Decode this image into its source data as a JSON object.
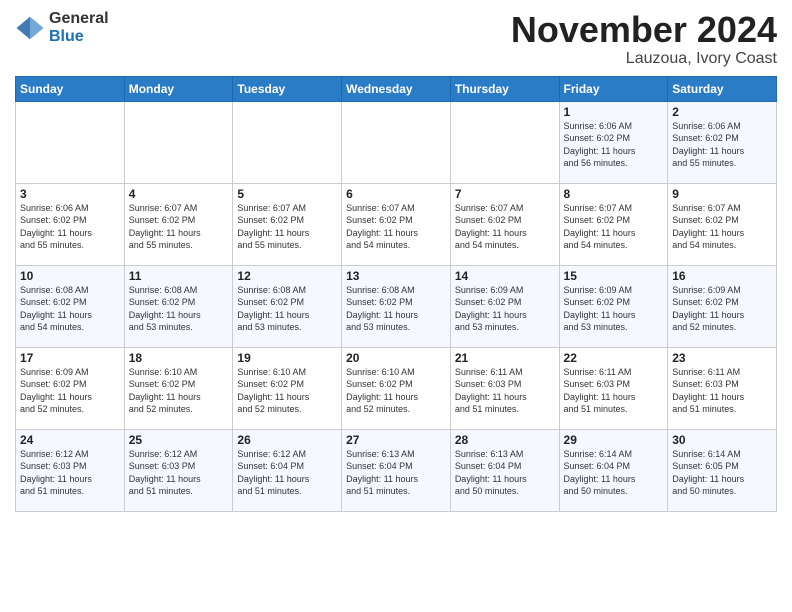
{
  "logo": {
    "line1": "General",
    "line2": "Blue"
  },
  "header": {
    "month": "November 2024",
    "location": "Lauzoua, Ivory Coast"
  },
  "weekdays": [
    "Sunday",
    "Monday",
    "Tuesday",
    "Wednesday",
    "Thursday",
    "Friday",
    "Saturday"
  ],
  "weeks": [
    [
      {
        "day": "",
        "info": ""
      },
      {
        "day": "",
        "info": ""
      },
      {
        "day": "",
        "info": ""
      },
      {
        "day": "",
        "info": ""
      },
      {
        "day": "",
        "info": ""
      },
      {
        "day": "1",
        "info": "Sunrise: 6:06 AM\nSunset: 6:02 PM\nDaylight: 11 hours\nand 56 minutes."
      },
      {
        "day": "2",
        "info": "Sunrise: 6:06 AM\nSunset: 6:02 PM\nDaylight: 11 hours\nand 55 minutes."
      }
    ],
    [
      {
        "day": "3",
        "info": "Sunrise: 6:06 AM\nSunset: 6:02 PM\nDaylight: 11 hours\nand 55 minutes."
      },
      {
        "day": "4",
        "info": "Sunrise: 6:07 AM\nSunset: 6:02 PM\nDaylight: 11 hours\nand 55 minutes."
      },
      {
        "day": "5",
        "info": "Sunrise: 6:07 AM\nSunset: 6:02 PM\nDaylight: 11 hours\nand 55 minutes."
      },
      {
        "day": "6",
        "info": "Sunrise: 6:07 AM\nSunset: 6:02 PM\nDaylight: 11 hours\nand 54 minutes."
      },
      {
        "day": "7",
        "info": "Sunrise: 6:07 AM\nSunset: 6:02 PM\nDaylight: 11 hours\nand 54 minutes."
      },
      {
        "day": "8",
        "info": "Sunrise: 6:07 AM\nSunset: 6:02 PM\nDaylight: 11 hours\nand 54 minutes."
      },
      {
        "day": "9",
        "info": "Sunrise: 6:07 AM\nSunset: 6:02 PM\nDaylight: 11 hours\nand 54 minutes."
      }
    ],
    [
      {
        "day": "10",
        "info": "Sunrise: 6:08 AM\nSunset: 6:02 PM\nDaylight: 11 hours\nand 54 minutes."
      },
      {
        "day": "11",
        "info": "Sunrise: 6:08 AM\nSunset: 6:02 PM\nDaylight: 11 hours\nand 53 minutes."
      },
      {
        "day": "12",
        "info": "Sunrise: 6:08 AM\nSunset: 6:02 PM\nDaylight: 11 hours\nand 53 minutes."
      },
      {
        "day": "13",
        "info": "Sunrise: 6:08 AM\nSunset: 6:02 PM\nDaylight: 11 hours\nand 53 minutes."
      },
      {
        "day": "14",
        "info": "Sunrise: 6:09 AM\nSunset: 6:02 PM\nDaylight: 11 hours\nand 53 minutes."
      },
      {
        "day": "15",
        "info": "Sunrise: 6:09 AM\nSunset: 6:02 PM\nDaylight: 11 hours\nand 53 minutes."
      },
      {
        "day": "16",
        "info": "Sunrise: 6:09 AM\nSunset: 6:02 PM\nDaylight: 11 hours\nand 52 minutes."
      }
    ],
    [
      {
        "day": "17",
        "info": "Sunrise: 6:09 AM\nSunset: 6:02 PM\nDaylight: 11 hours\nand 52 minutes."
      },
      {
        "day": "18",
        "info": "Sunrise: 6:10 AM\nSunset: 6:02 PM\nDaylight: 11 hours\nand 52 minutes."
      },
      {
        "day": "19",
        "info": "Sunrise: 6:10 AM\nSunset: 6:02 PM\nDaylight: 11 hours\nand 52 minutes."
      },
      {
        "day": "20",
        "info": "Sunrise: 6:10 AM\nSunset: 6:02 PM\nDaylight: 11 hours\nand 52 minutes."
      },
      {
        "day": "21",
        "info": "Sunrise: 6:11 AM\nSunset: 6:03 PM\nDaylight: 11 hours\nand 51 minutes."
      },
      {
        "day": "22",
        "info": "Sunrise: 6:11 AM\nSunset: 6:03 PM\nDaylight: 11 hours\nand 51 minutes."
      },
      {
        "day": "23",
        "info": "Sunrise: 6:11 AM\nSunset: 6:03 PM\nDaylight: 11 hours\nand 51 minutes."
      }
    ],
    [
      {
        "day": "24",
        "info": "Sunrise: 6:12 AM\nSunset: 6:03 PM\nDaylight: 11 hours\nand 51 minutes."
      },
      {
        "day": "25",
        "info": "Sunrise: 6:12 AM\nSunset: 6:03 PM\nDaylight: 11 hours\nand 51 minutes."
      },
      {
        "day": "26",
        "info": "Sunrise: 6:12 AM\nSunset: 6:04 PM\nDaylight: 11 hours\nand 51 minutes."
      },
      {
        "day": "27",
        "info": "Sunrise: 6:13 AM\nSunset: 6:04 PM\nDaylight: 11 hours\nand 51 minutes."
      },
      {
        "day": "28",
        "info": "Sunrise: 6:13 AM\nSunset: 6:04 PM\nDaylight: 11 hours\nand 50 minutes."
      },
      {
        "day": "29",
        "info": "Sunrise: 6:14 AM\nSunset: 6:04 PM\nDaylight: 11 hours\nand 50 minutes."
      },
      {
        "day": "30",
        "info": "Sunrise: 6:14 AM\nSunset: 6:05 PM\nDaylight: 11 hours\nand 50 minutes."
      }
    ]
  ]
}
